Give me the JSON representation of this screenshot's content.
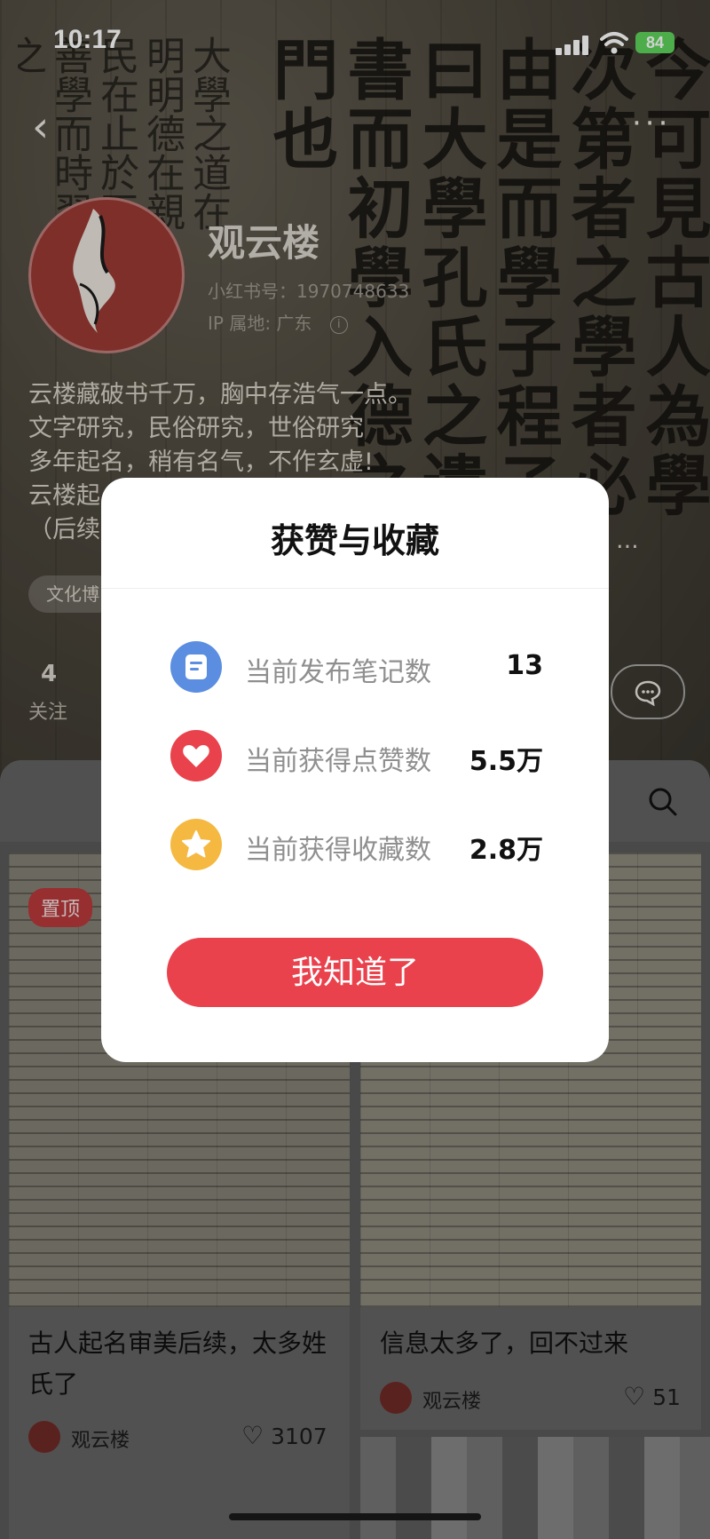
{
  "status_bar": {
    "time": "10:17",
    "battery": "84"
  },
  "background_text": {
    "large": "今可見古人為學次第者之學者必由是而學子程子曰大學孔氏之遺書而初學入德之門也",
    "small": "大學之道在明明德在親民在止於至善學而時習之"
  },
  "profile": {
    "name": "观云楼",
    "red_id": "小红书号：1970748633",
    "ip": "IP 属地: 广东",
    "bio_lines": [
      "云楼藏破书千万，胸中存浩气一点。",
      "文字研究，民俗研究，世俗研究",
      "多年起名，稍有名气，不作玄虚!",
      "云楼起",
      "（后续"
    ],
    "bio_tail": "字，...",
    "tag": "文化博",
    "following_count": "4",
    "following_label": "关注"
  },
  "modal": {
    "title": "获赞与收藏",
    "rows": [
      {
        "label": "当前发布笔记数",
        "value": "13",
        "icon": "note-icon",
        "color": "#5b8ee0"
      },
      {
        "label": "当前获得点赞数",
        "value": "5.5万",
        "icon": "heart-icon",
        "color": "#e9424c"
      },
      {
        "label": "当前获得收藏数",
        "value": "2.8万",
        "icon": "star-icon",
        "color": "#f5b942"
      }
    ],
    "ok_label": "我知道了"
  },
  "notes": [
    {
      "pinned_label": "置顶",
      "title": "古人起名审美后续，太多姓氏了",
      "author": "观云楼",
      "likes": "3107"
    },
    {
      "title": "信息太多了，回不过来",
      "author": "观云楼",
      "likes": "51"
    }
  ],
  "colors": {
    "accent": "#e9424c"
  }
}
